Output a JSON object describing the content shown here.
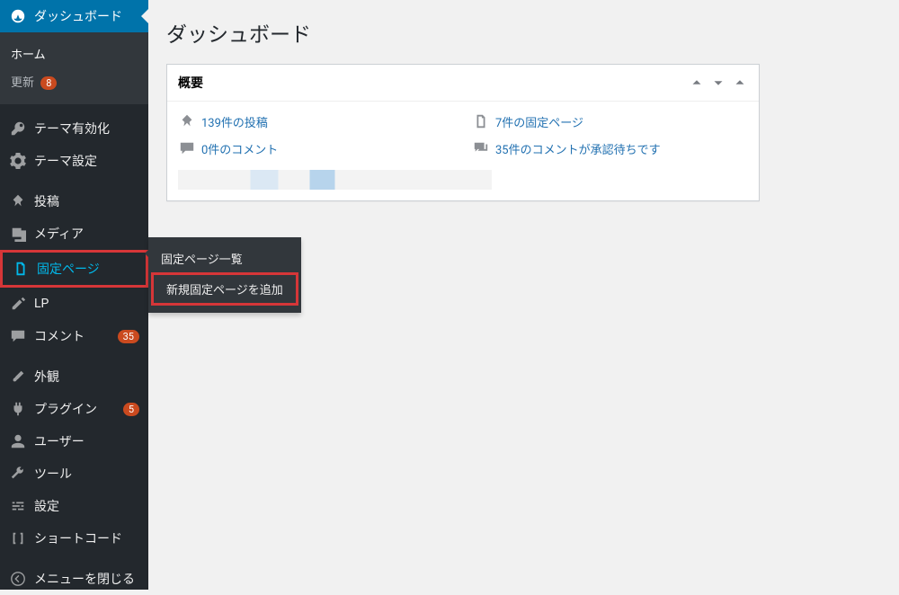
{
  "page": {
    "title": "ダッシュボード"
  },
  "sidebar": {
    "dashboard": "ダッシュボード",
    "home": "ホーム",
    "updates": "更新",
    "updates_badge": "8",
    "theme_activate": "テーマ有効化",
    "theme_settings": "テーマ設定",
    "posts": "投稿",
    "media": "メディア",
    "pages": "固定ページ",
    "lp": "LP",
    "comments": "コメント",
    "comments_badge": "35",
    "appearance": "外観",
    "plugins": "プラグイン",
    "plugins_badge": "5",
    "users": "ユーザー",
    "tools": "ツール",
    "settings": "設定",
    "shortcode": "ショートコード",
    "collapse": "メニューを閉じる"
  },
  "flyout": {
    "pages_list": "固定ページ一覧",
    "pages_add": "新規固定ページを追加"
  },
  "panel": {
    "title": "概要",
    "stat_posts": "139件の投稿",
    "stat_pages": "7件の固定ページ",
    "stat_comments": "0件のコメント",
    "stat_pending": "35件のコメントが承認待ちです"
  }
}
